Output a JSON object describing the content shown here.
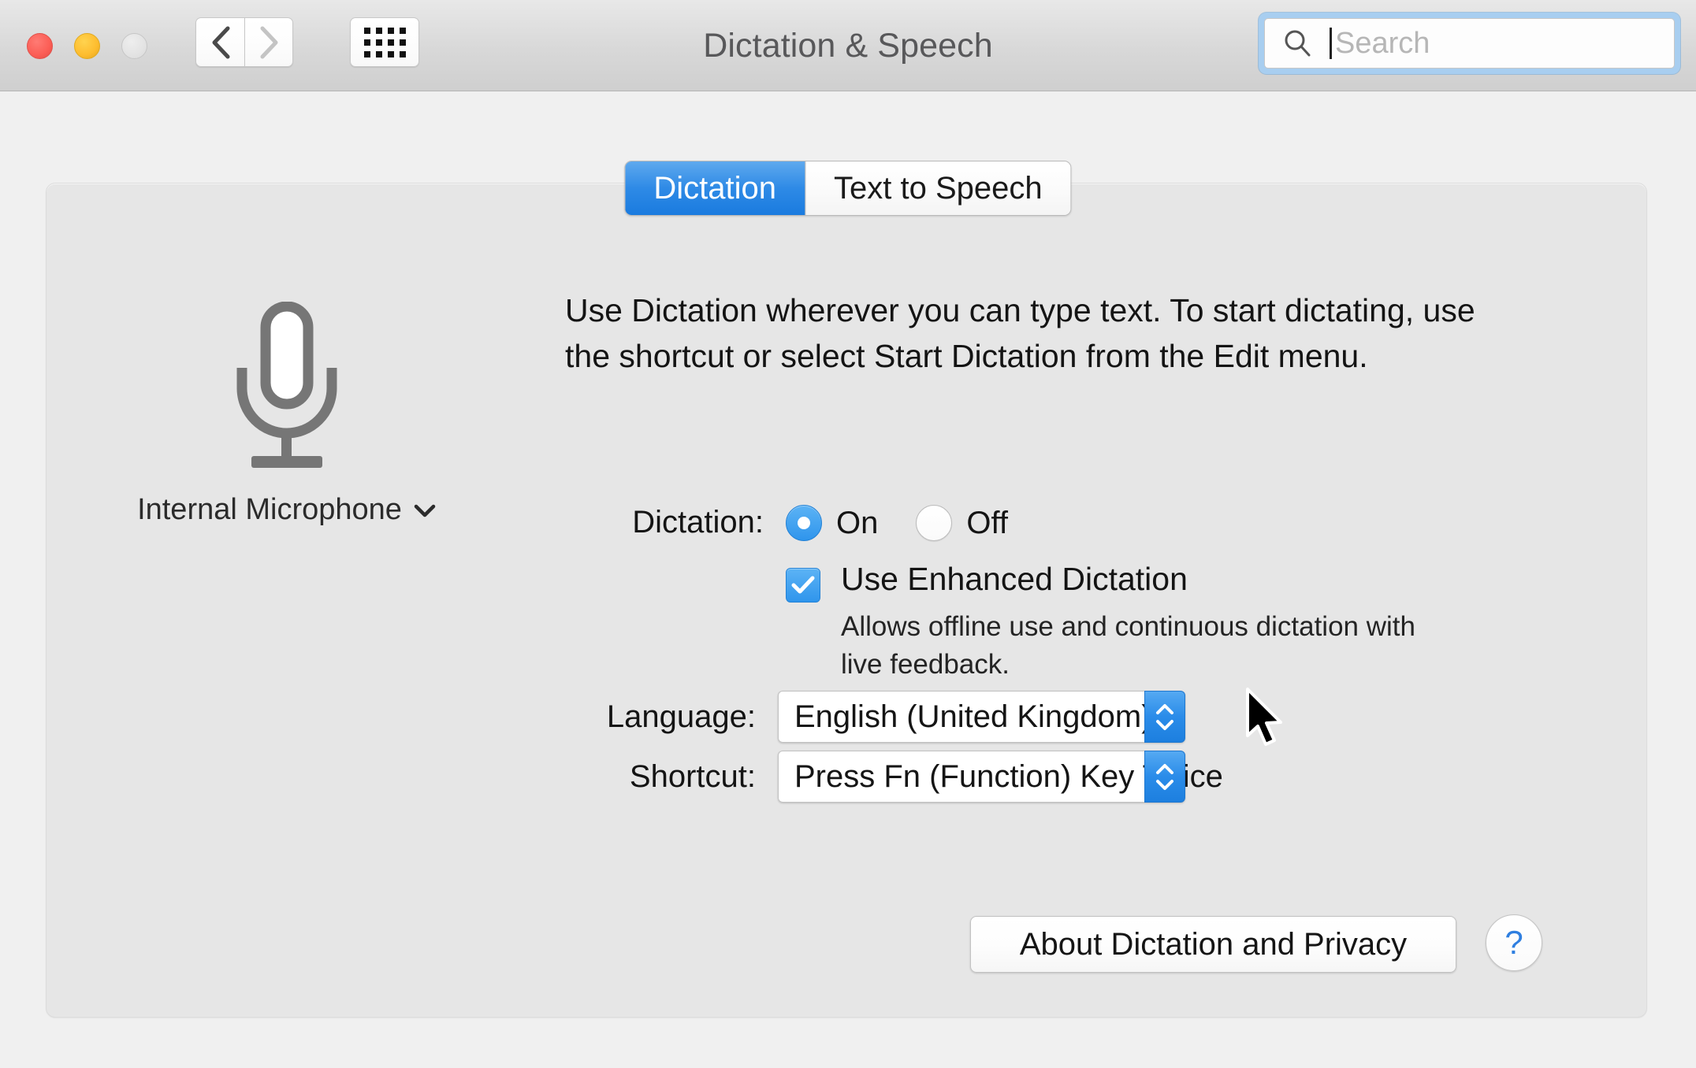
{
  "window": {
    "title": "Dictation & Speech",
    "controls": {
      "close": "close-button",
      "minimize": "minimize-button",
      "zoom": "zoom-button"
    },
    "toolbar": {
      "back": "back-button",
      "forward": "forward-button",
      "show_all": "show-all-button"
    }
  },
  "search": {
    "placeholder": "Search",
    "value": "",
    "icon": "search-icon"
  },
  "tabs": [
    {
      "label": "Dictation",
      "selected": true
    },
    {
      "label": "Text to Speech",
      "selected": false
    }
  ],
  "microphone": {
    "icon": "microphone-icon",
    "label": "Internal Microphone",
    "chevron": "chevron-down-icon"
  },
  "description": "Use Dictation wherever you can type text. To start dictating, use the shortcut or select Start Dictation from the Edit menu.",
  "dictation": {
    "label": "Dictation:",
    "options": [
      {
        "label": "On",
        "selected": true
      },
      {
        "label": "Off",
        "selected": false
      }
    ]
  },
  "enhanced": {
    "checked": true,
    "label": "Use Enhanced Dictation",
    "sublabel": "Allows offline use and continuous dictation with live feedback."
  },
  "language": {
    "label": "Language:",
    "value": "English (United Kingdom)"
  },
  "shortcut": {
    "label": "Shortcut:",
    "value": "Press Fn (Function) Key Twice"
  },
  "footer": {
    "about_button": "About Dictation and Privacy",
    "help_button": "?"
  },
  "colors": {
    "accent_blue": "#2f95ec",
    "tab_active": "#2e8ae6",
    "close_red": "#fb5d55",
    "minimize_yellow": "#fdbc2e",
    "panel_bg": "#e6e6e6",
    "window_bg": "#f0f0f0",
    "help_blue": "#2f7fe0"
  }
}
